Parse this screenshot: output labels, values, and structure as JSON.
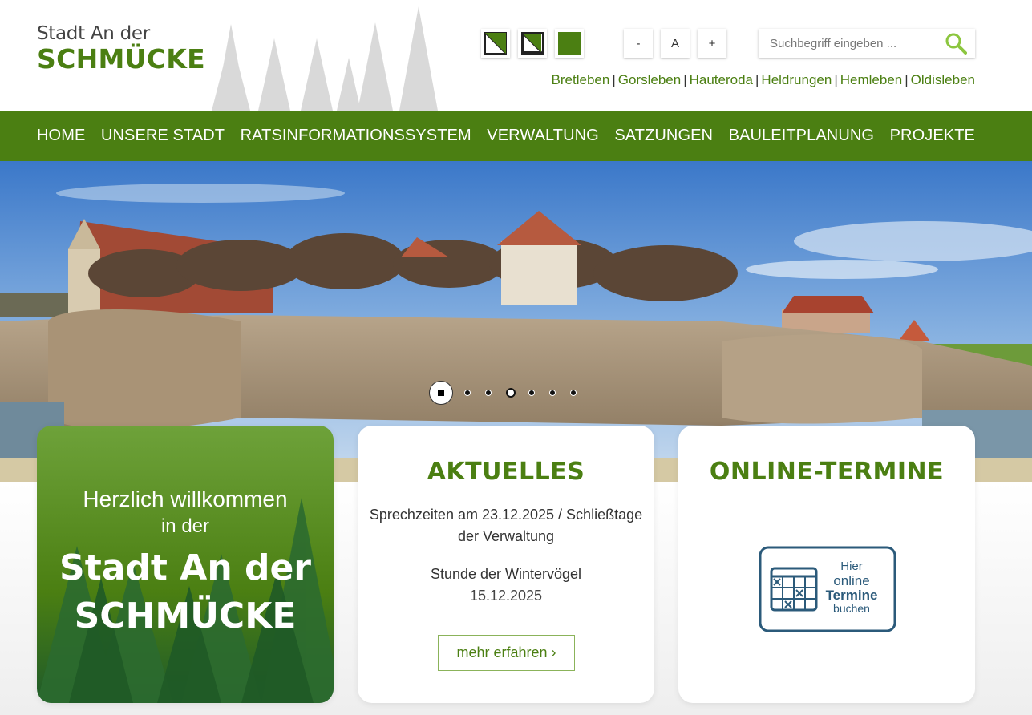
{
  "header": {
    "logo_line1": "Stadt An der",
    "logo_line2": "SCHMÜCKE",
    "font_size_buttons": [
      "-",
      "A",
      "+"
    ],
    "search_placeholder": "Suchbegriff eingeben ...",
    "towns": [
      "Bretleben",
      "Gorsleben",
      "Hauteroda",
      "Heldrungen",
      "Hemleben",
      "Oldisleben"
    ],
    "contrast_icons": [
      "contrast-normal-icon",
      "contrast-inverted-icon",
      "contrast-green-icon"
    ]
  },
  "nav": {
    "items": [
      "HOME",
      "UNSERE STADT",
      "RATSINFORMATIONSSYSTEM",
      "VERWALTUNG",
      "SATZUNGEN",
      "BAULEITPLANUNG",
      "PROJEKTE"
    ]
  },
  "slider": {
    "slide_count": 7,
    "active_index": 0
  },
  "welcome": {
    "line1": "Herzlich willkommen",
    "line2": "in der",
    "line3": "Stadt An der",
    "line4": "SCHMÜCKE"
  },
  "news": {
    "title": "AKTUELLES",
    "item1": "Sprechzeiten am 23.12.2025 / Schließtage der Verwaltung",
    "item2_title": "Stunde der Wintervögel",
    "item2_date": "15.12.2025",
    "more_label": "mehr erfahren ›"
  },
  "appointments": {
    "title": "ONLINE-TERMINE",
    "badge_line1": "Hier",
    "badge_line2": "online",
    "badge_line3": "Termine",
    "badge_line4": "buchen"
  },
  "colors": {
    "brand_green": "#4b7f12",
    "link_green": "#4b7f12",
    "badge_blue": "#2b5a7a"
  }
}
